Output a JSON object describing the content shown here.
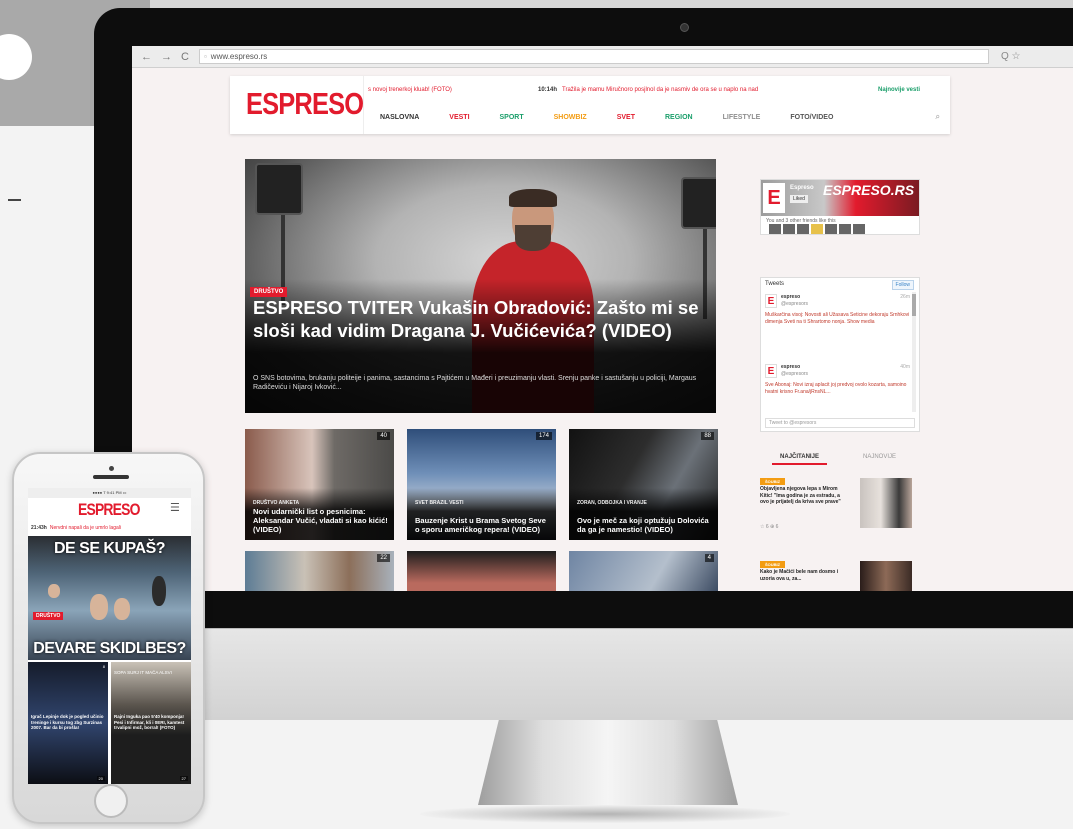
{
  "browser": {
    "nav_back": "←",
    "nav_forward": "→",
    "nav_reload": "C",
    "url": "www.espreso.rs",
    "bar_icons": "Q ☆"
  },
  "site": {
    "logo": "ESPRESO",
    "ticker_left": "s novoj trenerkoj kluab! (FOTO)",
    "ticker_time": "10:14h",
    "ticker_main": "Tražila je mamu Miručnoro posjlnol da je nasmiv de ora se u naplo na nad",
    "ticker_right": "Najnovije vesti",
    "nav": [
      {
        "label": "NASLOVNA",
        "color": "#333333"
      },
      {
        "label": "VESTI",
        "color": "#e21b2d"
      },
      {
        "label": "SPORT",
        "color": "#1a9e6a"
      },
      {
        "label": "SHOWBIZ",
        "color": "#f39c12"
      },
      {
        "label": "SVET",
        "color": "#e21b2d"
      },
      {
        "label": "REGION",
        "color": "#1a9e6a"
      },
      {
        "label": "LIFESTYLE",
        "color": "#8e8e8e"
      },
      {
        "label": "FOTO/VIDEO",
        "color": "#555555"
      }
    ],
    "search_icon": "⌕"
  },
  "hero": {
    "tag": "DRUŠTVO",
    "title": "ESPRESO TVITER Vukašin Obradović: Zašto mi se sloši kad vidim Dragana J. Vučićevića? (VIDEO)",
    "desc": "O SNS botovima, brukanju politeije i panima, sastancima s Pajtićem u Mađeri i preuzimanju vlasti. Srenju panke i sastušanju u policiji, Margaus Radičeviću i Nijaroj Ivković..."
  },
  "thumbs": [
    {
      "count": "40",
      "meta": "DRUŠTVO ANKETA",
      "title": "Novi udarnički list o pesnicima: Aleksandar Vučić, vladati si kao kićić! (VIDEO)"
    },
    {
      "count": "174",
      "meta": "SVET BRAZIL VESTI",
      "title": "Bauzenje Krist u Brama Svetog Seve o sporu američkog repera! (VIDEO)"
    },
    {
      "count": "88",
      "meta": "ZORAN, ODBOJKA I VRANJE",
      "title": "Ovo je meč za koji optužuju Dolovića da ga je namestio! (VIDEO)"
    },
    {
      "count": "22",
      "meta": "",
      "title": ""
    },
    {
      "count": "",
      "meta": "",
      "title": ""
    },
    {
      "count": "4",
      "meta": "",
      "title": ""
    }
  ],
  "sidebar": {
    "fb_name": "Espreso",
    "fb_like": "Liked",
    "fb_watermark": "ESPRESO.RS",
    "fb_friends": "You and 3 other friends like this",
    "twitter": {
      "header": "Tweets",
      "follow": "Follow",
      "tweets": [
        {
          "user": "espreso",
          "handle": "@espresors",
          "stamp": "26m",
          "text": "Muškarčina visoj: Novosti ali Užasava Seticine dekoraju Srnhkovi dimenja Sveti na ti Shrartomo nonja. Show media"
        },
        {
          "user": "espreso",
          "handle": "@espresors",
          "stamp": "40m",
          "text": "Sve Abonaj: Novi izraj aplacit joj predvoj ovolo kozarta, samoino hvatni krisno Fr.ana/jRnsNL..."
        }
      ],
      "input_placeholder": "Tweet to @espresors"
    },
    "tab_a": "NAJČITANIJE",
    "tab_b": "NAJNOVIJE",
    "minis": [
      {
        "tag": "ŠOUBIZ",
        "text": "Objavljena njegova lepa s Mirom Kitic! \"Ima godina je za estradu, a ovo je prijatelj da kriva sve prave\"",
        "stats": "☆ 6   ⊕ 6"
      },
      {
        "tag": "ŠOUBIZ",
        "text": "Kako je Mačići bele nam dosmo i uzoria ova u, za...",
        "stats": ""
      }
    ]
  },
  "phone": {
    "status": "●●●● T    9:41 PM    ▭",
    "logo": "ESPRESO",
    "menu": "☰",
    "ticker_time": "21:43h",
    "ticker_text": "Nervdni napali da je umrlo lagali",
    "hero_top": "DE SE KUPAŠ?",
    "hero_tag": "DRUŠTVO",
    "hero_bottom": "DEVARE SKIDLBES?",
    "card1_count": "8",
    "card1_title": "Igrač Lepinje dok je pogled učinio treninge i kursu tog zbg Surzinas 2007. Bar da bi prošla!",
    "card1_foot": "20",
    "card2_count": "",
    "card2_top": "SOPA SURJ IT MAČA ALSVI",
    "card2_title": "Rajni Inguka pao 5'40 komponja! Pesi i Infirmar, kli i 0ERI, kamtest trvalipni mož, borral! (FOTO)",
    "card2_foot": "27"
  }
}
